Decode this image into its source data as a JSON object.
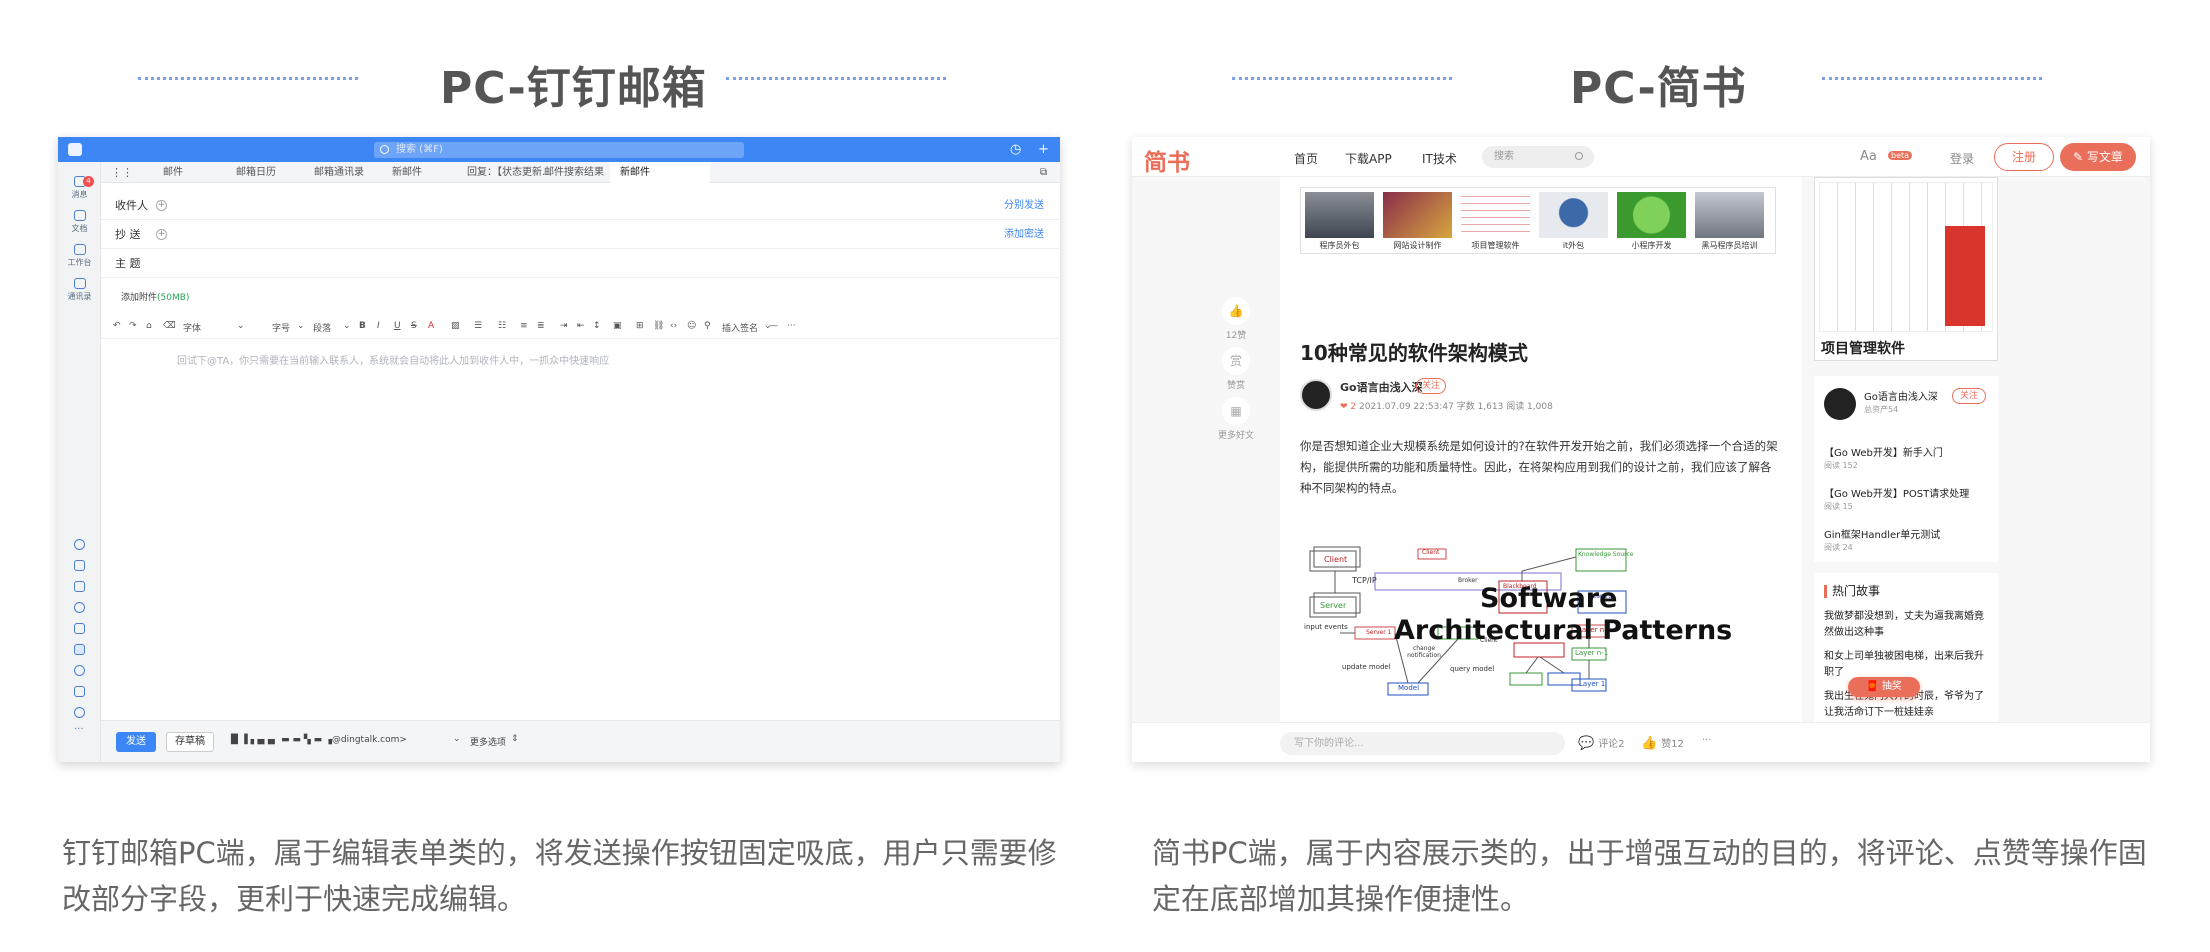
{
  "left": {
    "title": "PC-钉钉邮箱",
    "caption": "钉钉邮箱PC端，属于编辑表单类的，将发送操作按钮固定吸底，用户只需要修改部分字段，更利于快速完成编辑。",
    "app": {
      "search_placeholder": "搜索 (⌘F)",
      "rail": [
        {
          "label": "消息",
          "icon": "message-icon",
          "badge": "4"
        },
        {
          "label": "文档",
          "icon": "document-icon"
        },
        {
          "label": "工作台",
          "icon": "workbench-icon"
        },
        {
          "label": "通讯录",
          "icon": "contacts-icon"
        }
      ],
      "tabs": [
        "邮件",
        "邮箱日历",
        "邮箱通讯录",
        "新邮件",
        "回复：【状态更新…",
        "邮件搜索结果",
        "新邮件"
      ],
      "fields": {
        "to": "收件人",
        "cc": "抄  送",
        "subject": "主  题",
        "split_send": "分别发送",
        "add_bcc": "添加密送"
      },
      "attach_label": "添加附件",
      "attach_size": "(50MB)",
      "toolbar": {
        "font": "字体",
        "size": "字号",
        "paragraph": "段落",
        "signature": "插入签名"
      },
      "editor_placeholder": "回试下@TA，你只需要在当前输入联系人，系统就会自动将此人加到收件人中，一抓众中快速响应",
      "send": "发送",
      "draft": "存草稿",
      "sender": "█ ▐ ▖▄▗▖ ▬ ▬ ▚ ▬ ▗@dingtalk.com>",
      "more_options": "更多选项"
    }
  },
  "right": {
    "title": "PC-简书",
    "caption": "简书PC端，属于内容展示类的，出于增强互动的目的，将评论、点赞等操作固定在底部增加其操作便捷性。",
    "app": {
      "brand": "简书",
      "nav": [
        "首页",
        "下载APP",
        "IT技术"
      ],
      "search_placeholder": "搜索",
      "aa": "Aa",
      "beta": "beta",
      "login": "登录",
      "register": "注册",
      "write": "写文章",
      "side_actions": [
        "12赞",
        "赞赏",
        "更多好文"
      ],
      "thumb_captions": [
        "程序员外包",
        "网站设计制作",
        "项目管理软件",
        "it外包",
        "小程序开发",
        "黑马程序员培训"
      ],
      "article_title": "10种常见的软件架构模式",
      "author": "Go语言由浅入深",
      "follow": "关注",
      "meta_likes": "2",
      "meta": "2021.07.09 22:53:47  字数 1,613  阅读 1,008",
      "body": "你是否想知道企业大规模系统是如何设计的?在软件开发开始之前，我们必须选择一个合适的架构，能提供所需的功能和质量特性。因此，在将架构应用到我们的设计之前，我们应该了解各种不同架构的特点。",
      "diagram_title1": "Software",
      "diagram_title2": "Architectural Patterns",
      "diagram_labels": [
        "Client",
        "TCP/IP",
        "Server",
        "Client",
        "Broker",
        "Knowledge Source",
        "Blackboard",
        "Control",
        "Layer n",
        "Layer n-1",
        "Layer 1",
        "Model",
        "input events",
        "change notification",
        "update model",
        "query model",
        "Server 1",
        "Client"
      ],
      "ad_caption": "项目管理软件",
      "aside_author": "Go语言由浅入深",
      "aside_asset": "总资产54",
      "aside_follow": "关注",
      "posts": [
        {
          "title": "【Go Web开发】新手入门",
          "reads": "阅读 152"
        },
        {
          "title": "【Go Web开发】POST请求处理",
          "reads": "阅读 15"
        },
        {
          "title": "Gin框架Handler单元测试",
          "reads": "阅读 24"
        }
      ],
      "hot_title": "热门故事",
      "hot_items": [
        "我做梦都没想到，丈夫为逼我离婚竟然做出这种事",
        "和女上司单独被困电梯，出来后我升职了",
        "我出生在鬼门大开的时辰，爷爷为了让我活命订下一桩娃娃亲"
      ],
      "red_packet": "抽奖",
      "comment_placeholder": "写下你的评论...",
      "comments": "评论2",
      "likes": "赞12"
    }
  }
}
